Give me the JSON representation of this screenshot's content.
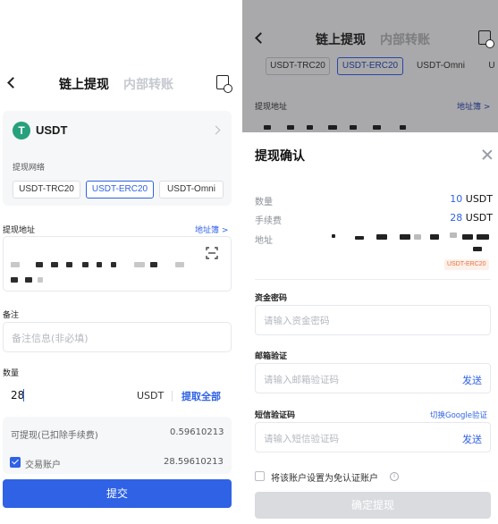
{
  "left": {
    "header": {
      "back": "<",
      "tab_active": "链上提现",
      "tab_inactive": "内部转账",
      "record_icon": "record-icon"
    },
    "coin": {
      "icon": "tether-icon",
      "symbol": "T",
      "name": "USDT"
    },
    "network": {
      "label": "提现网络",
      "options": [
        "USDT-TRC20",
        "USDT-ERC20",
        "USDT-Omni"
      ],
      "selected": "USDT-ERC20"
    },
    "address": {
      "label": "提现地址",
      "book_link": "地址簿 >",
      "scan_icon": "scan-icon"
    },
    "memo": {
      "label": "备注",
      "placeholder": "备注信息(非必填)"
    },
    "amount": {
      "label": "数量",
      "value": "28",
      "unit": "USDT",
      "withdraw_all": "提取全部"
    },
    "available": {
      "label": "可提现(已扣除手续费)",
      "value": "0.59610213"
    },
    "account": {
      "label": "交易账户",
      "value": "28.59610213",
      "checked": true
    },
    "submit": "提交"
  },
  "right": {
    "bg": {
      "back": "<",
      "tab_active": "链上提现",
      "tab_inactive": "内部转账",
      "networks": [
        "USDT-TRC20",
        "USDT-ERC20",
        "USDT-Omni",
        "U"
      ],
      "selected": "USDT-ERC20",
      "address_label": "提现地址",
      "book_link": "地址簿 >"
    },
    "sheet": {
      "title": "提现确认",
      "close_icon": "close-icon",
      "rows": [
        {
          "key": "数量",
          "num": "10",
          "unit": "USDT"
        },
        {
          "key": "手续费",
          "num": "28",
          "unit": "USDT"
        }
      ],
      "address_key": "地址",
      "network_tag": "USDT-ERC20",
      "fund_password": {
        "label": "资金密码",
        "placeholder": "请输入资金密码"
      },
      "email": {
        "label": "邮箱验证",
        "placeholder": "请输入邮箱验证码",
        "send": "发送"
      },
      "sms": {
        "label": "短信验证码",
        "google_link": "切换Google验证",
        "placeholder": "请输入短信验证码",
        "send": "发送"
      },
      "whitelist": {
        "label": "将该账户设置为免认证账户",
        "info_icon": "i",
        "checked": false
      },
      "confirm": "确定提现"
    }
  }
}
